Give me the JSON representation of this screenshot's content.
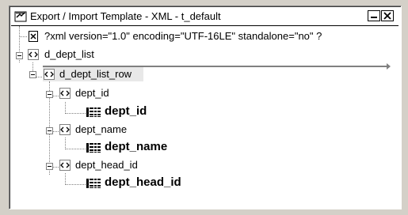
{
  "window": {
    "title": "Export / Import Template - XML - t_default"
  },
  "tree": {
    "xml_decl": "?xml version=\"1.0\" encoding=\"UTF-16LE\" standalone=\"no\" ?",
    "root": "d_dept_list",
    "row": "d_dept_list_row",
    "children": [
      {
        "element": "dept_id",
        "column": "dept_id"
      },
      {
        "element": "dept_name",
        "column": "dept_name"
      },
      {
        "element": "dept_head_id",
        "column": "dept_head_id"
      }
    ]
  },
  "icons": {
    "title": "template-icon",
    "xml_decl": "document-icon",
    "element": "xml-element-icon",
    "column": "column-icon"
  }
}
